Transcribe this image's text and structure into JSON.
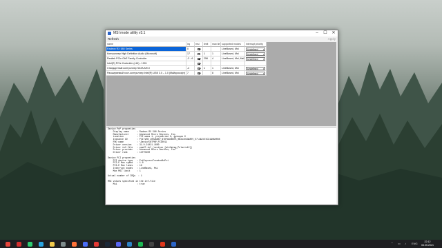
{
  "window": {
    "title": "MSI mode utility v3.1",
    "menu_refresh": "Refresh",
    "menu_apply": "Apply"
  },
  "table": {
    "headers": [
      "name",
      "irq",
      "msi",
      "limit",
      "max limit",
      "supported modes",
      "interrupt priority"
    ],
    "rows": [
      {
        "name": "Radeon RX 580 Series",
        "irq": "0",
        "msi": true,
        "limit": "",
        "max_limit": "",
        "modes": "LineBased, Msi",
        "priority": "Undefined",
        "selected": true
      },
      {
        "name": "Контроллер High Definition Audio (Microsoft)",
        "irq": "17",
        "msi": false,
        "limit": "1",
        "max_limit": "1",
        "modes": "LineBased, Msi",
        "priority": "Undefined",
        "selected": false
      },
      {
        "name": "Realtek PCIe GbE Family Controller",
        "irq": "-3 - 6",
        "msi": true,
        "limit": "256",
        "max_limit": "4",
        "modes": "LineBased, Msi, MsiX",
        "priority": "Undefined",
        "selected": false
      },
      {
        "name": "Intel(R) PCIe Controller (x16) - 1901",
        "irq": "",
        "msi": true,
        "limit": "",
        "max_limit": "",
        "modes": "",
        "priority": "",
        "selected": false
      },
      {
        "name": "Стандартный контроллер SATA AHCI",
        "irq": "-2",
        "msi": true,
        "limit": "1",
        "max_limit": "1",
        "modes": "LineBased, Msi",
        "priority": "Undefined",
        "selected": false
      },
      {
        "name": "Расширяемый хост-контроллер Intel(R) USB 3.0 – 1.0 (Майкрософт)",
        "irq": "7",
        "msi": true,
        "limit": "",
        "max_limit": "8",
        "modes": "LineBased, Msi",
        "priority": "Undefined",
        "selected": false
      }
    ]
  },
  "details_text": "Device PnP properties\n    Display name      : Radeon RX 580 Series\n    Manufacturer      : Advanced Micro Devices, Inc.\n    Location          : PCI шина 1, устройство 0, функция 0\n    Instance ID       : PCI\\VEN_1002&DEV_67DF&SUBSYS_0B311043&REV_E7\\4&2474C31&0&0008\n    PDO name          : \\Device\\NTPNP_PCI0011\n    Driver version    : 31.0.21021.1000\n    Driver inf-file   : oem27.inf (section [ati2mtag_Polaris12])\n    Driver provider   : Advanced Micro Devices, Inc.\n    Driver rank       : 13ff0200\n\nDevice PCI properties\n    PCI device type   : PciExpressTreatedAsPci\n    PCI-E Max speed   : 1.0\n    PCI-E Max lanes   : 16\n    Interrupt modes   : LineBased, Msi\n    Max MSI limit     : 1\n\nActual number of IRQs  : 1\n\nMSI values specified in the inf-file\n    Msi               : true",
  "taskbar": {
    "icons": [
      "chrome-icon",
      "opera-icon",
      "whatsapp-icon",
      "telegram-icon",
      "folder-icon",
      "calculator-icon",
      "firefox-icon",
      "vpn-icon",
      "radeon-icon",
      "steam-icon",
      "discord-icon",
      "teamspeak-icon",
      "spotify-icon",
      "epic-icon",
      "adobe-icon",
      "msi-utility-icon"
    ],
    "language": "ENG",
    "time": "22:12",
    "date": "06.05.2021"
  },
  "colors": {
    "selection": "#0a64d8",
    "taskbar": "#1f1f22"
  }
}
